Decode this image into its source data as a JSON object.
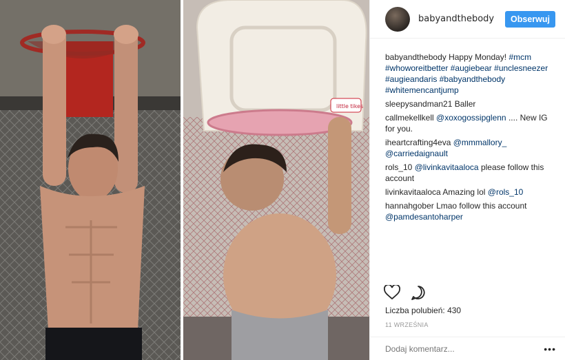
{
  "post": {
    "username": "babyandthebody",
    "follow_label": "Obserwuj",
    "caption_author": "babyandthebody",
    "caption_text": "Happy Monday!",
    "caption_tags": [
      "#mcm",
      "#whoworeitbetter",
      "#augiebear",
      "#unclesneezer",
      "#augieandaris",
      "#babyandthebody",
      "#whitemencantjump"
    ],
    "comments": [
      {
        "author": "sleepysandman21",
        "text": "Baller",
        "mention": ""
      },
      {
        "author": "callmekellkell",
        "text": ".... New IG for you.",
        "mention": "@xoxogossipglenn"
      },
      {
        "author": "iheartcrafting4eva",
        "text": "@carriedaignault",
        "mention": "@mmmallory_"
      },
      {
        "author": "rols_10",
        "text": "please follow this account",
        "mention": "@livinkavitaaloca"
      },
      {
        "author": "livinkavitaaloca",
        "text": "Amazing lol",
        "mention": "@rols_10"
      },
      {
        "author": "hannahgober",
        "text": "Lmao follow this account",
        "mention": "@pamdesantoharper"
      }
    ],
    "likes_label": "Liczba polubień:",
    "likes_count": "430",
    "date": "11 WRZEŚNIA",
    "comment_placeholder": "Dodaj komentarz...",
    "more_icon": "more-horizontal-icon",
    "like_icon": "heart-icon",
    "comment_icon": "speech-bubble-icon",
    "accent_color": "#3897f0",
    "hoop_brand": "little tikes"
  }
}
